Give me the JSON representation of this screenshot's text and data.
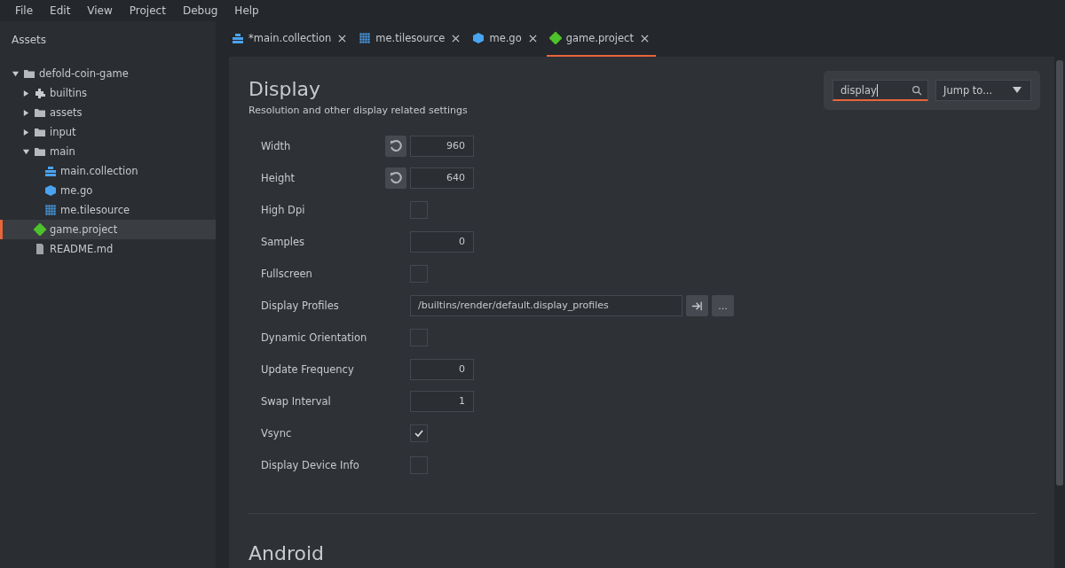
{
  "menu": [
    "File",
    "Edit",
    "View",
    "Project",
    "Debug",
    "Help"
  ],
  "sidebar": {
    "title": "Assets",
    "tree": [
      {
        "label": "defold-coin-game",
        "kind": "folder",
        "expanded": true,
        "selected": false,
        "children": [
          {
            "label": "builtins",
            "kind": "library",
            "expanded": false,
            "selected": false
          },
          {
            "label": "assets",
            "kind": "folder",
            "expanded": false,
            "selected": false
          },
          {
            "label": "input",
            "kind": "folder",
            "expanded": false,
            "selected": false
          },
          {
            "label": "main",
            "kind": "folder",
            "expanded": true,
            "selected": false,
            "children": [
              {
                "label": "main.collection",
                "kind": "collection",
                "selected": false
              },
              {
                "label": "me.go",
                "kind": "gameobject",
                "selected": false
              },
              {
                "label": "me.tilesource",
                "kind": "tilesource",
                "selected": false
              }
            ]
          },
          {
            "label": "game.project",
            "kind": "project",
            "selected": true
          },
          {
            "label": "README.md",
            "kind": "file",
            "selected": false
          }
        ]
      }
    ]
  },
  "tabs": [
    {
      "label": "*main.collection",
      "kind": "collection",
      "selected": false
    },
    {
      "label": "me.tilesource",
      "kind": "tilesource",
      "selected": false
    },
    {
      "label": "me.go",
      "kind": "gameobject",
      "selected": false
    },
    {
      "label": "game.project",
      "kind": "project",
      "selected": true
    }
  ],
  "section": {
    "title": "Display",
    "subtitle": "Resolution and other display related settings",
    "fields": [
      {
        "label": "Width",
        "kind": "number",
        "value": "960",
        "reset": true
      },
      {
        "label": "Height",
        "kind": "number",
        "value": "640",
        "reset": true
      },
      {
        "label": "High Dpi",
        "kind": "checkbox",
        "checked": false
      },
      {
        "label": "Samples",
        "kind": "number",
        "value": "0"
      },
      {
        "label": "Fullscreen",
        "kind": "checkbox",
        "checked": false
      },
      {
        "label": "Display Profiles",
        "kind": "resource",
        "value": "/builtins/render/default.display_profiles",
        "browse": "..."
      },
      {
        "label": "Dynamic Orientation",
        "kind": "checkbox",
        "checked": false
      },
      {
        "label": "Update Frequency",
        "kind": "number",
        "value": "0"
      },
      {
        "label": "Swap Interval",
        "kind": "number",
        "value": "1"
      },
      {
        "label": "Vsync",
        "kind": "checkbox",
        "checked": true
      },
      {
        "label": "Display Device Info",
        "kind": "checkbox",
        "checked": false
      }
    ]
  },
  "next_section": {
    "title": "Android"
  },
  "search": {
    "value": "display"
  },
  "jump": {
    "label": "Jump to..."
  }
}
